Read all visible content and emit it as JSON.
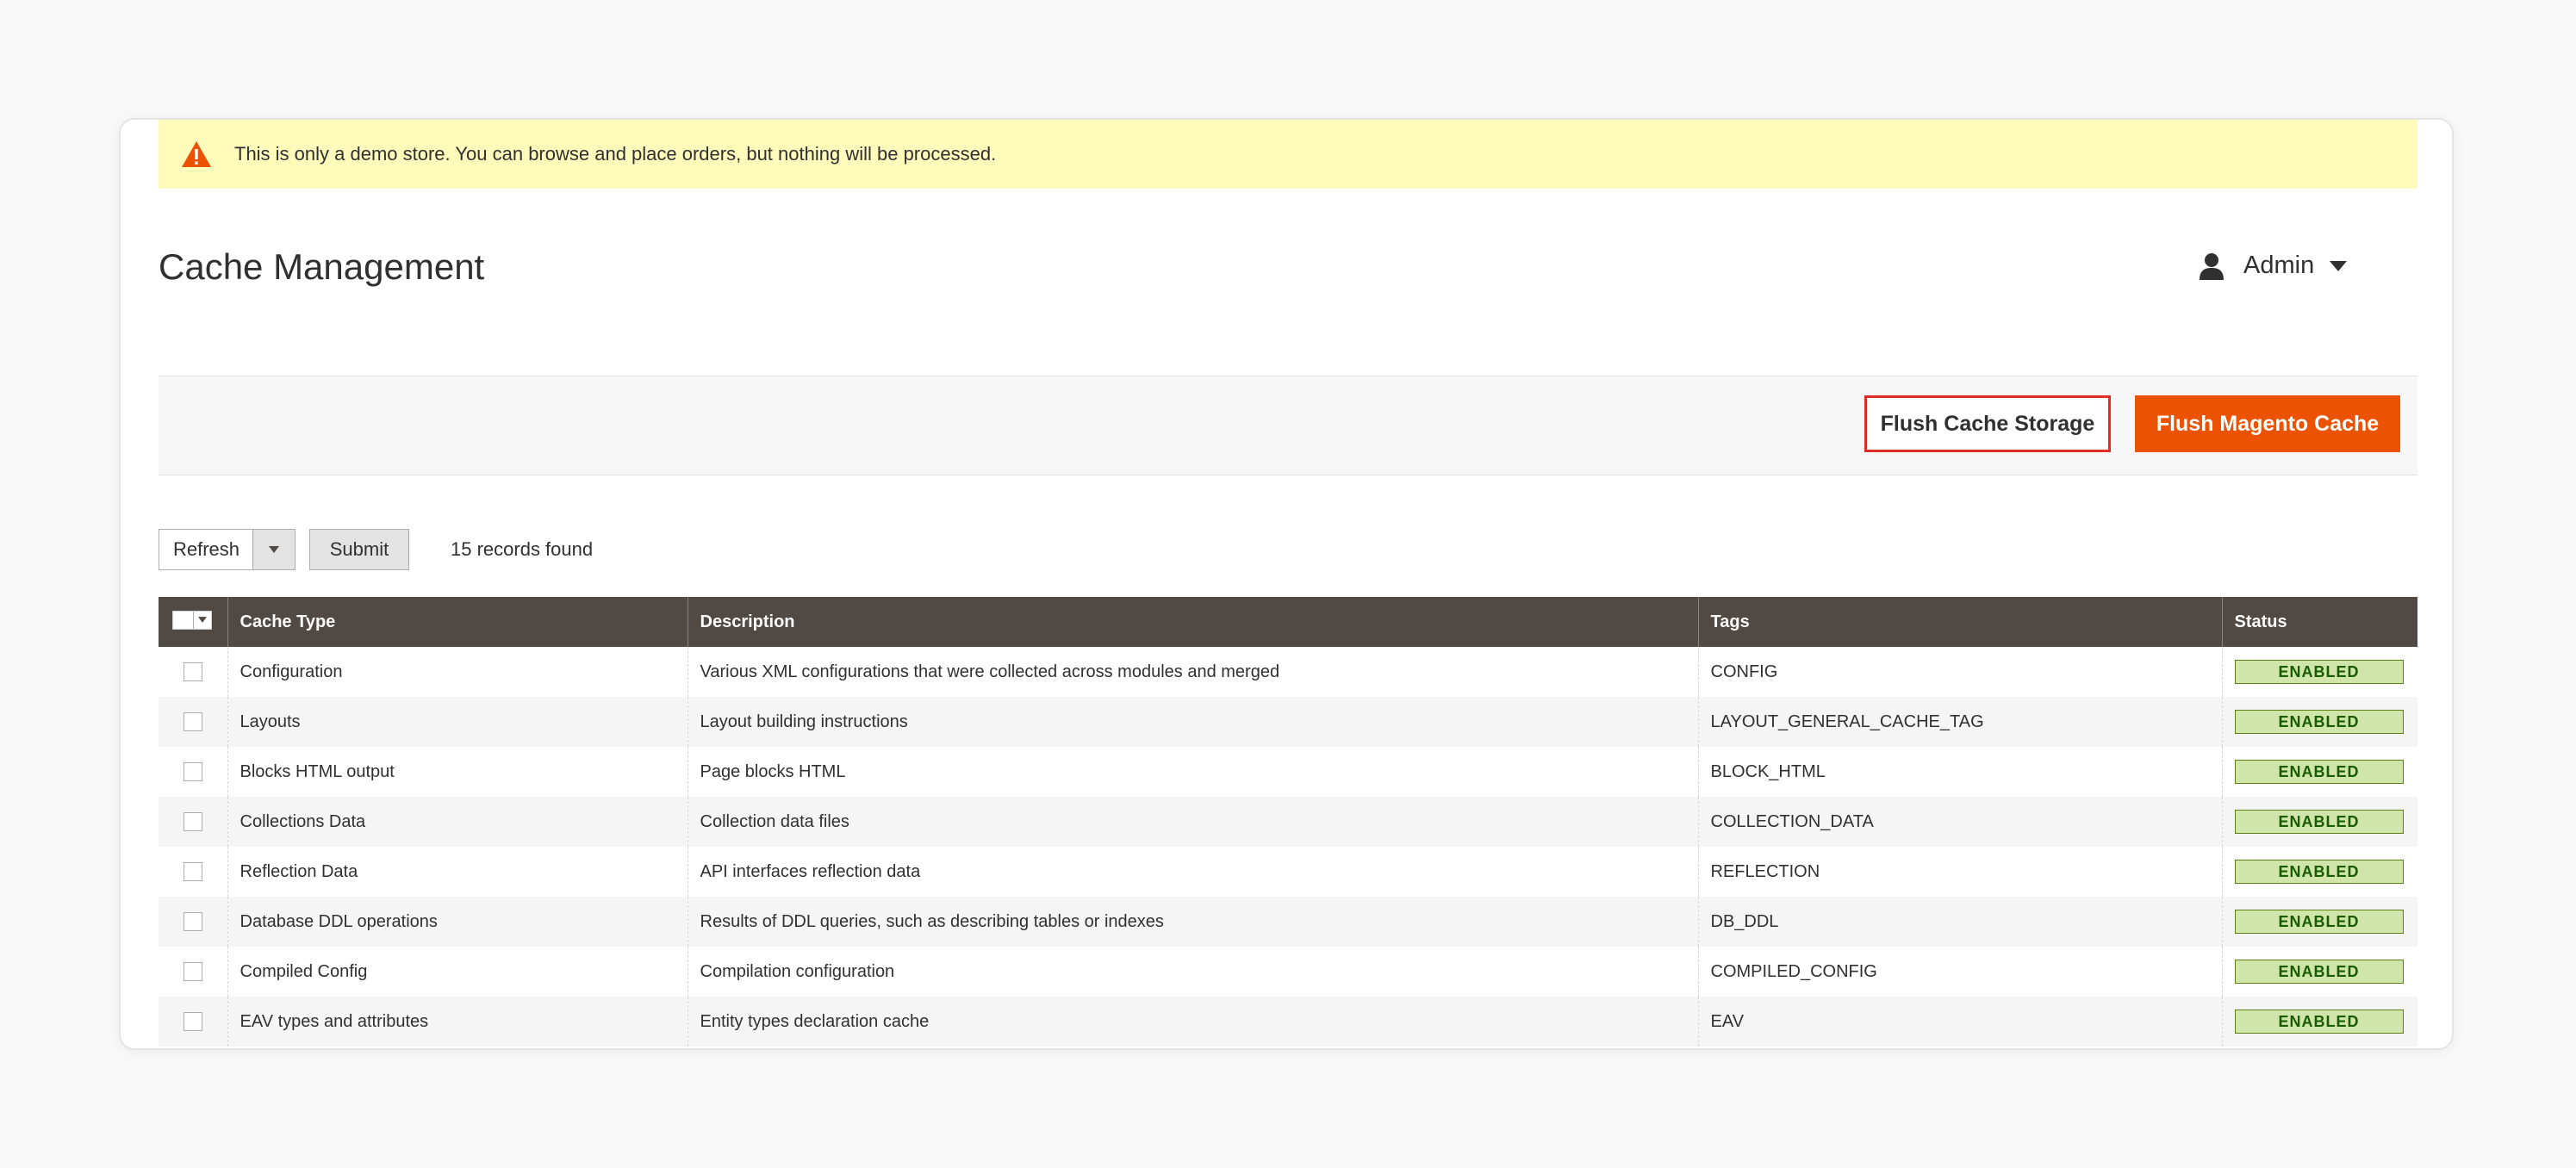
{
  "notice": {
    "icon": "warning-icon",
    "text": "This is only a demo store. You can browse and place orders, but nothing will be processed."
  },
  "header": {
    "title": "Cache Management",
    "user_icon": "user-icon",
    "user_label": "Admin"
  },
  "actions": {
    "flush_storage": "Flush Cache Storage",
    "flush_magento": "Flush Magento Cache"
  },
  "mass_action": {
    "selected": "Refresh",
    "submit": "Submit",
    "records": "15 records found"
  },
  "grid": {
    "columns": [
      "Cache Type",
      "Description",
      "Tags",
      "Status"
    ],
    "rows": [
      {
        "type": "Configuration",
        "description": "Various XML configurations that were collected across modules and merged",
        "tags": "CONFIG",
        "status": "ENABLED"
      },
      {
        "type": "Layouts",
        "description": "Layout building instructions",
        "tags": "LAYOUT_GENERAL_CACHE_TAG",
        "status": "ENABLED"
      },
      {
        "type": "Blocks HTML output",
        "description": "Page blocks HTML",
        "tags": "BLOCK_HTML",
        "status": "ENABLED"
      },
      {
        "type": "Collections Data",
        "description": "Collection data files",
        "tags": "COLLECTION_DATA",
        "status": "ENABLED"
      },
      {
        "type": "Reflection Data",
        "description": "API interfaces reflection data",
        "tags": "REFLECTION",
        "status": "ENABLED"
      },
      {
        "type": "Database DDL operations",
        "description": "Results of DDL queries, such as describing tables or indexes",
        "tags": "DB_DDL",
        "status": "ENABLED"
      },
      {
        "type": "Compiled Config",
        "description": "Compilation configuration",
        "tags": "COMPILED_CONFIG",
        "status": "ENABLED"
      },
      {
        "type": "EAV types and attributes",
        "description": "Entity types declaration cache",
        "tags": "EAV",
        "status": "ENABLED"
      }
    ]
  },
  "colors": {
    "accent": "#eb5202",
    "header_bg": "#514943",
    "notice_bg": "#fffbbb",
    "enabled_bg": "#d0e5a9",
    "enabled_text": "#185b00"
  }
}
